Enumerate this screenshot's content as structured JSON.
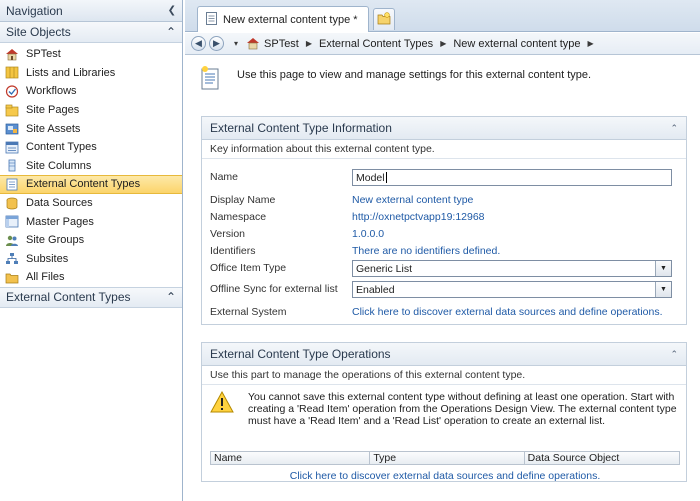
{
  "nav": {
    "header": "Navigation",
    "site_objects_label": "Site Objects",
    "items": [
      {
        "label": "SPTest",
        "icon": "site-icon"
      },
      {
        "label": "Lists and Libraries",
        "icon": "lists-icon"
      },
      {
        "label": "Workflows",
        "icon": "workflow-icon"
      },
      {
        "label": "Site Pages",
        "icon": "pages-icon"
      },
      {
        "label": "Site Assets",
        "icon": "assets-icon"
      },
      {
        "label": "Content Types",
        "icon": "content-types-icon"
      },
      {
        "label": "Site Columns",
        "icon": "columns-icon"
      },
      {
        "label": "External Content Types",
        "icon": "external-content-types-icon",
        "selected": true
      },
      {
        "label": "Data Sources",
        "icon": "database-icon"
      },
      {
        "label": "Master Pages",
        "icon": "master-pages-icon"
      },
      {
        "label": "Site Groups",
        "icon": "groups-icon"
      },
      {
        "label": "Subsites",
        "icon": "subsites-icon"
      },
      {
        "label": "All Files",
        "icon": "folder-icon"
      }
    ],
    "bottom_section_label": "External Content Types"
  },
  "tab": {
    "title": "New external content type *"
  },
  "breadcrumb": {
    "items": [
      "SPTest",
      "External Content Types",
      "New external content type"
    ]
  },
  "main": {
    "intro_text": "Use this page to view and manage settings for this external content type.",
    "info_panel": {
      "title": "External Content Type Information",
      "description": "Key information about this external content type.",
      "name_label": "Name",
      "name_value": "Model",
      "display_name_label": "Display Name",
      "display_name_value": "New external content type",
      "namespace_label": "Namespace",
      "namespace_value": "http://oxnetpctvapp19:12968",
      "version_label": "Version",
      "version_value": "1.0.0.0",
      "identifiers_label": "Identifiers",
      "identifiers_value": "There are no identifiers defined.",
      "office_item_type_label": "Office Item Type",
      "office_item_type_value": "Generic List",
      "offline_sync_label": "Offline Sync for external list",
      "offline_sync_value": "Enabled",
      "external_system_label": "External System",
      "external_system_value": "Click here to discover external data sources and define operations."
    },
    "ops_panel": {
      "title": "External Content Type Operations",
      "description": "Use this part to manage the operations of this external content type.",
      "warning_text": "You cannot save this external content type without defining at least one operation. Start with creating a 'Read Item' operation from the Operations Design View. The external content type must have a 'Read Item' and a 'Read List' operation to create an external list.",
      "columns": [
        "Name",
        "Type",
        "Data Source Object"
      ],
      "link_text": "Click here to discover external data sources and define operations."
    }
  },
  "colors": {
    "accent": "#1f5aa6",
    "selected_bg": "#fbd46b",
    "border": "#9fb4cc"
  }
}
